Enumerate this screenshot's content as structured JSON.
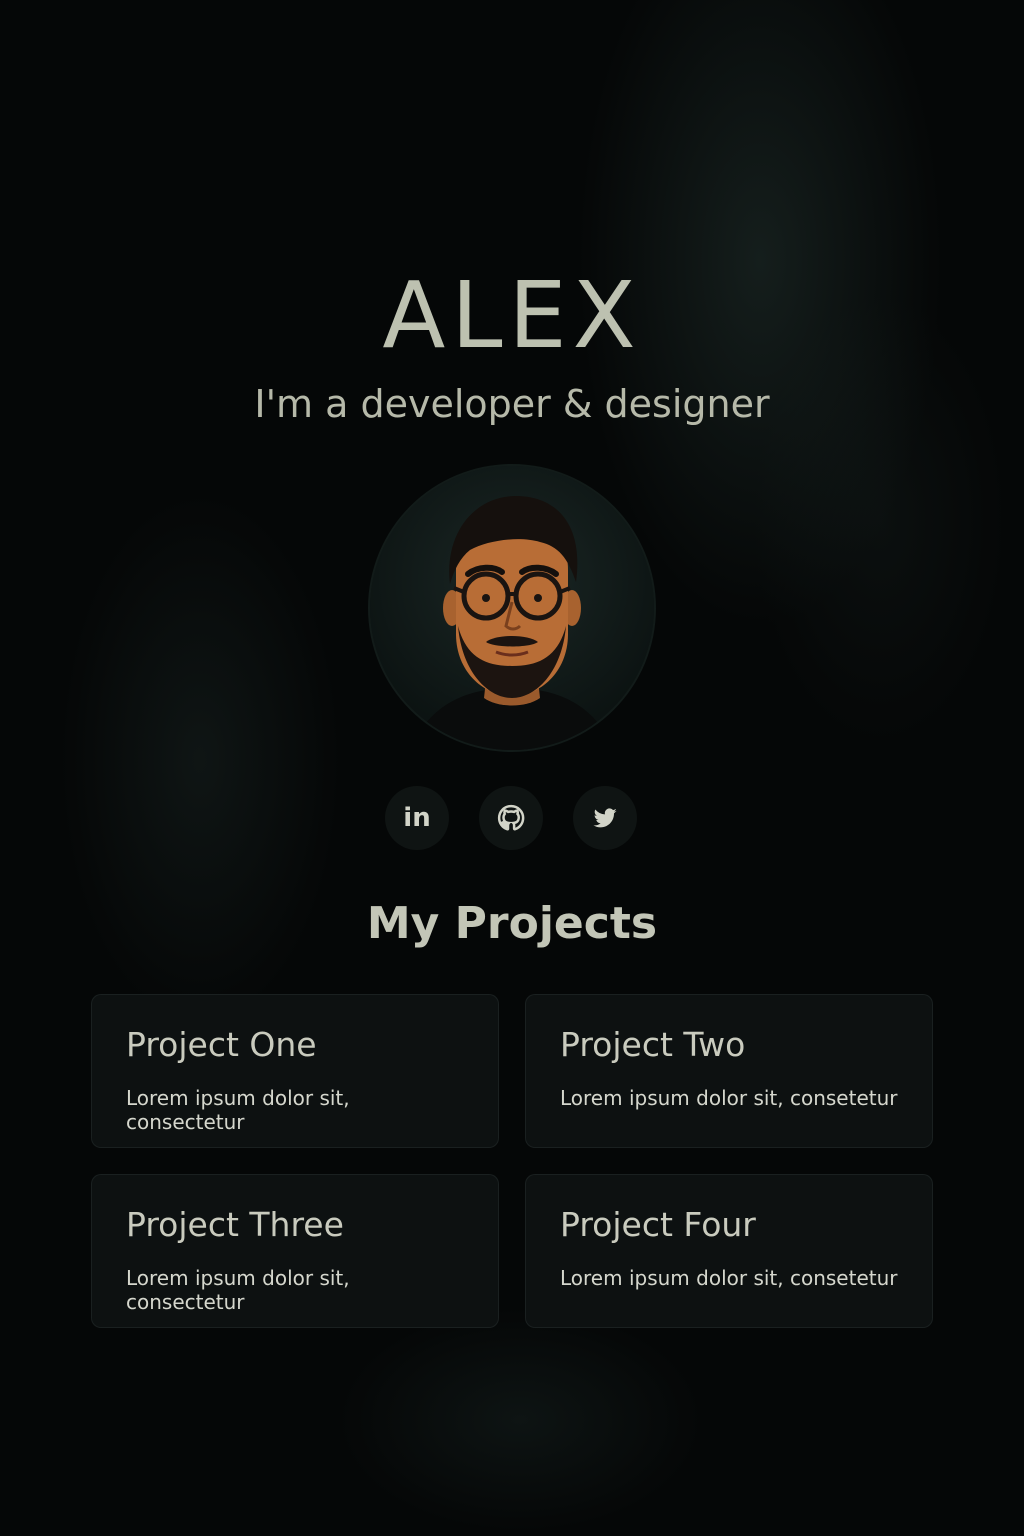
{
  "hero": {
    "name": "ALEX",
    "tagline": "I'm a developer & designer"
  },
  "avatar": {
    "description_icon": "portrait-avatar"
  },
  "socials": [
    {
      "icon": "linkedin-icon",
      "label": "in"
    },
    {
      "icon": "github-icon"
    },
    {
      "icon": "twitter-icon"
    }
  ],
  "projects_section": {
    "title": "My Projects",
    "items": [
      {
        "title": "Project One",
        "desc": "Lorem ipsum dolor sit, consectetur"
      },
      {
        "title": "Project Two",
        "desc": "Lorem ipsum dolor sit, consetetur"
      },
      {
        "title": "Project Three",
        "desc": "Lorem ipsum dolor sit, consectetur"
      },
      {
        "title": "Project Four",
        "desc": "Lorem ipsum dolor sit, consetetur"
      }
    ]
  },
  "colors": {
    "background": "#050707",
    "text": "#c9cbbe",
    "card": "#0e1212"
  }
}
